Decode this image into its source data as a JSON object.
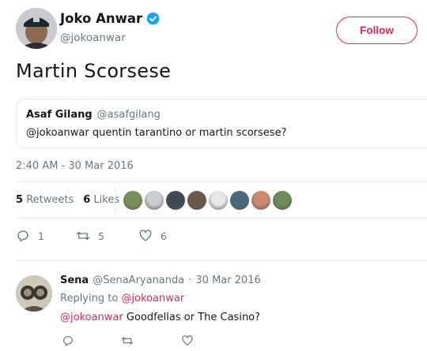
{
  "tweet": {
    "author_name": "Joko Anwar",
    "author_handle": "@jokoanwar",
    "follow_label": "Follow",
    "text": "Martin Scorsese",
    "timestamp": "2:40 AM - 30 Mar 2016"
  },
  "quote": {
    "name": "Asaf Gilang",
    "handle": "@asafgilang",
    "text": "@jokoanwar quentin tarantino or martin scorsese?"
  },
  "stats": {
    "retweets_count": "5",
    "retweets_label": "Retweets",
    "likes_count": "6",
    "likes_label": "Likes"
  },
  "likers": [
    "#7a8f5c",
    "#c9cdd1",
    "#3e4a55",
    "#6b5a4a",
    "#e8e8e8",
    "#4a6a7a",
    "#c98a70",
    "#6f8b5a"
  ],
  "actions": {
    "reply_count": "1",
    "retweet_count": "5",
    "like_count": "6"
  },
  "reply": {
    "name": "Sena",
    "handle": "@SenaAryananda",
    "separator": "·",
    "date": "30 Mar 2016",
    "replying_label": "Replying to",
    "replying_to": "@jokoanwar",
    "mention": "@jokoanwar",
    "text": " Goodfellas or The Casino?"
  },
  "colors": {
    "accent": "#e0245e",
    "verified": "#1da1f2",
    "muted": "#657786"
  }
}
